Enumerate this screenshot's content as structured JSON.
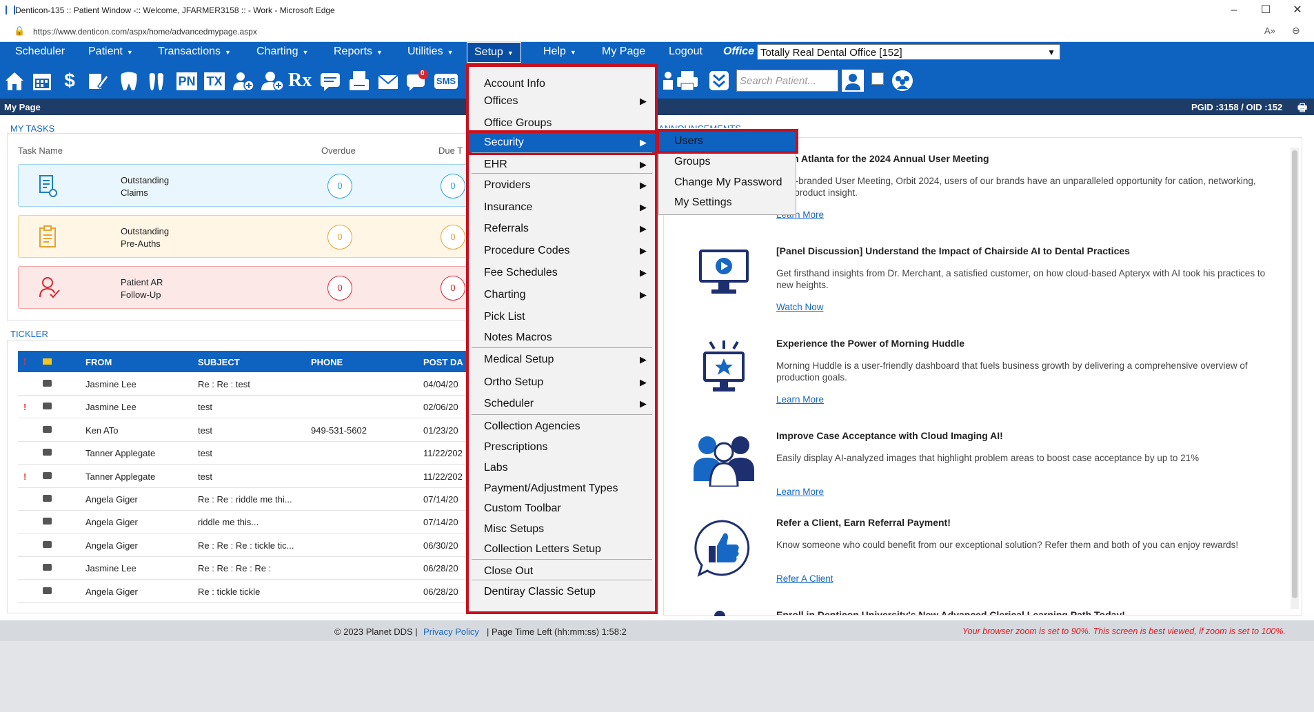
{
  "window": {
    "title": "Denticon-135 :: Patient Window -:: Welcome, JFARMER3158 :: - Work - Microsoft Edge",
    "url": "https://www.denticon.com/aspx/home/advancedmypage.aspx"
  },
  "nav": {
    "items": [
      "Scheduler",
      "Patient",
      "Transactions",
      "Charting",
      "Reports",
      "Utilities",
      "Setup",
      "Help",
      "My Page",
      "Logout"
    ],
    "office_label": "Office",
    "office_value": "Totally Real Dental Office [152]"
  },
  "toolbar": {
    "search_placeholder": "Search Patient...",
    "pn": "PN",
    "tx": "TX",
    "rx": "Rx",
    "sms": "SMS",
    "badge": "0"
  },
  "pagebar": {
    "title": "My Page",
    "ids": "PGID :3158  /  OID :152"
  },
  "tasks": {
    "section": "MY TASKS",
    "col_name": "Task Name",
    "col_overdue": "Overdue",
    "col_due": "Due T",
    "items": [
      {
        "line1": "Outstanding",
        "line2": "Claims",
        "overdue": "0",
        "due": "0"
      },
      {
        "line1": "Outstanding",
        "line2": "Pre-Auths",
        "overdue": "0",
        "due": "0"
      },
      {
        "line1": "Patient AR",
        "line2": "Follow-Up",
        "overdue": "0",
        "due": "0"
      }
    ]
  },
  "tickler": {
    "section": "TICKLER",
    "headers": {
      "from": "FROM",
      "subject": "SUBJECT",
      "phone": "PHONE",
      "post": "POST DA"
    },
    "rows": [
      {
        "flag": "",
        "from": "Jasmine Lee",
        "subject": "Re : Re : test",
        "phone": "",
        "post": "04/04/20"
      },
      {
        "flag": "!",
        "from": "Jasmine Lee",
        "subject": "test",
        "phone": "",
        "post": "02/06/20"
      },
      {
        "flag": "",
        "from": "Ken ATo",
        "subject": "test",
        "phone": "949-531-5602",
        "post": "01/23/20"
      },
      {
        "flag": "",
        "from": "Tanner Applegate",
        "subject": "test",
        "phone": "",
        "post": "11/22/202"
      },
      {
        "flag": "!",
        "from": "Tanner Applegate",
        "subject": "test",
        "phone": "",
        "post": "11/22/202"
      },
      {
        "flag": "",
        "from": "Angela Giger",
        "subject": "Re : Re : riddle me thi...",
        "phone": "",
        "post": "07/14/20"
      },
      {
        "flag": "",
        "from": "Angela Giger",
        "subject": "riddle me this...",
        "phone": "",
        "post": "07/14/20"
      },
      {
        "flag": "",
        "from": "Angela Giger",
        "subject": "Re : Re : Re : tickle tic...",
        "phone": "",
        "post": "06/30/20"
      },
      {
        "flag": "",
        "from": "Jasmine Lee",
        "subject": "Re : Re : Re : Re :",
        "phone": "",
        "post": "06/28/20"
      },
      {
        "flag": "",
        "from": "Angela Giger",
        "subject": "Re : tickle tickle",
        "phone": "",
        "post": "06/28/20"
      }
    ]
  },
  "announcements": {
    "section": "ANNOUNCEMENTS",
    "items": [
      {
        "title": "us in Atlanta for the 2024 Annual User Meeting",
        "body": "ur re-branded User Meeting, Orbit 2024, users of our brands have an unparalleled opportunity for cation, networking, and product insight.",
        "link": "Learn More"
      },
      {
        "title": "[Panel Discussion] Understand the Impact of Chairside AI to Dental Practices",
        "body": "Get firsthand insights from Dr. Merchant, a satisfied customer, on how cloud-based Apteryx with AI took his practices to new heights.",
        "link": "Watch Now"
      },
      {
        "title": "Experience the Power of Morning Huddle",
        "body": "Morning Huddle is a user-friendly dashboard that fuels business growth by delivering a comprehensive overview of production goals.",
        "link": "Learn More"
      },
      {
        "title": "Improve Case Acceptance with Cloud Imaging AI!",
        "body": "Easily display AI-analyzed images that highlight problem areas to boost case acceptance by up to 21%",
        "link": "Learn More"
      },
      {
        "title": "Refer a Client, Earn Referral Payment!",
        "body": "Know someone who could benefit from our exceptional solution? Refer them and both of you can enjoy rewards!",
        "link": "Refer A Client"
      },
      {
        "title": "Enroll in Denticon University's New Advanced Clerical Learning Path Today!",
        "body": "",
        "link": ""
      }
    ]
  },
  "setup_menu": {
    "items": [
      {
        "label": "Account Info",
        "sub": false
      },
      {
        "label": "Offices",
        "sub": true
      },
      {
        "label": "Office Groups",
        "sub": false
      },
      {
        "label": "Security",
        "sub": true
      },
      {
        "label": "EHR",
        "sub": true
      },
      {
        "label": "Providers",
        "sub": true
      },
      {
        "label": "Insurance",
        "sub": true
      },
      {
        "label": "Referrals",
        "sub": true
      },
      {
        "label": "Procedure Codes",
        "sub": true
      },
      {
        "label": "Fee Schedules",
        "sub": true
      },
      {
        "label": "Charting",
        "sub": true
      },
      {
        "label": "Pick List",
        "sub": false
      },
      {
        "label": "Notes Macros",
        "sub": false
      },
      {
        "label": "Medical Setup",
        "sub": true
      },
      {
        "label": "Ortho Setup",
        "sub": true
      },
      {
        "label": "Scheduler",
        "sub": true
      },
      {
        "label": "Collection Agencies",
        "sub": false
      },
      {
        "label": "Prescriptions",
        "sub": false
      },
      {
        "label": "Labs",
        "sub": false
      },
      {
        "label": "Payment/Adjustment Types",
        "sub": false
      },
      {
        "label": "Custom Toolbar",
        "sub": false
      },
      {
        "label": "Misc Setups",
        "sub": false
      },
      {
        "label": "Collection Letters Setup",
        "sub": false
      },
      {
        "label": "Close Out",
        "sub": false
      },
      {
        "label": "Dentiray Classic Setup",
        "sub": false
      }
    ]
  },
  "security_menu": {
    "items": [
      "Users",
      "Groups",
      "Change My Password",
      "My Settings"
    ]
  },
  "footer": {
    "copyright": "© 2023 Planet DDS |",
    "privacy": "Privacy Policy",
    "page_time": "| Page Time Left (hh:mm:ss) 1:58:2",
    "zoom_warning": "Your browser zoom is set to 90%. This screen is best viewed, if zoom is set to 100%."
  },
  "colors": {
    "brand_blue": "#0e62c0",
    "highlight_red": "#c8101e",
    "header_navy": "#1d3c68"
  }
}
